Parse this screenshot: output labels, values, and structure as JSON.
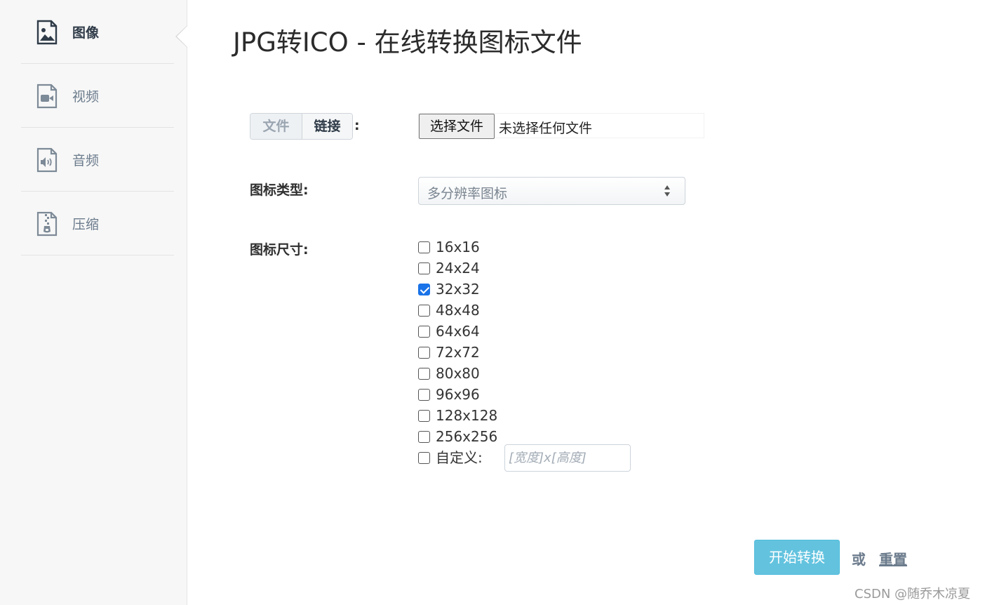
{
  "sidebar": {
    "items": [
      {
        "label": "图像",
        "icon": "image-file-icon",
        "active": true
      },
      {
        "label": "视频",
        "icon": "video-file-icon",
        "active": false
      },
      {
        "label": "音频",
        "icon": "audio-file-icon",
        "active": false
      },
      {
        "label": "压缩",
        "icon": "zip-file-icon",
        "active": false
      }
    ]
  },
  "page": {
    "title": "JPG转ICO - 在线转换图标文件"
  },
  "source": {
    "tabs": [
      "文件",
      "链接"
    ],
    "active_tab": "链接",
    "colon": ":",
    "file_button": "选择文件",
    "file_status": "未选择任何文件"
  },
  "icon_type": {
    "label": "图标类型:",
    "selected": "多分辨率图标"
  },
  "icon_size": {
    "label": "图标尺寸:",
    "options": [
      {
        "label": "16x16",
        "checked": false
      },
      {
        "label": "24x24",
        "checked": false
      },
      {
        "label": "32x32",
        "checked": true
      },
      {
        "label": "48x48",
        "checked": false
      },
      {
        "label": "64x64",
        "checked": false
      },
      {
        "label": "72x72",
        "checked": false
      },
      {
        "label": "80x80",
        "checked": false
      },
      {
        "label": "96x96",
        "checked": false
      },
      {
        "label": "128x128",
        "checked": false
      },
      {
        "label": "256x256",
        "checked": false
      }
    ],
    "custom_label": "自定义:",
    "custom_checked": false,
    "custom_placeholder": "[宽度]x[高度]"
  },
  "actions": {
    "convert": "开始转换",
    "or": "或",
    "reset": "重置"
  },
  "watermark": "CSDN @随乔木凉夏",
  "colors": {
    "accent_button": "#5bc0de",
    "checkbox_checked": "#1a73e8",
    "muted_text": "#6b7b8c"
  }
}
